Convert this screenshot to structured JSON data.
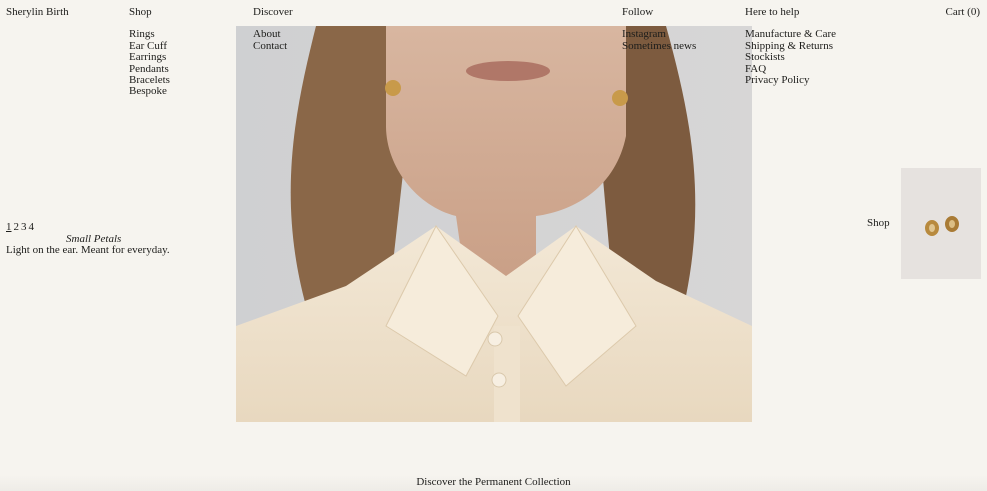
{
  "brand": "Sherylin Birth",
  "nav": {
    "shop": {
      "title": "Shop",
      "items": [
        "Rings",
        "Ear Cuff",
        "Earrings",
        "Pendants",
        "Bracelets",
        "Bespoke"
      ]
    },
    "discover": {
      "title": "Discover",
      "items": [
        "About",
        "Contact"
      ]
    },
    "follow": {
      "title": "Follow",
      "items": [
        "Instagram",
        "Sometimes news"
      ]
    },
    "help": {
      "title": "Here to help",
      "items": [
        "Manufacture & Care",
        "Shipping & Returns",
        "Stockists",
        "FAQ",
        "Privacy Policy"
      ]
    }
  },
  "cart": "Cart (0)",
  "slideshow": {
    "pages": [
      "1",
      "2",
      "3",
      "4"
    ],
    "current_page": "1",
    "title": "Small Petals",
    "description": "Light on the ear. Meant for everyday."
  },
  "shop_link": "Shop",
  "cta": "Discover the Permanent Collection",
  "colors": {
    "background": "#f6f4ef",
    "text": "#1d1d1b",
    "shirt": "#efe3cf",
    "hair": "#8a6748"
  }
}
